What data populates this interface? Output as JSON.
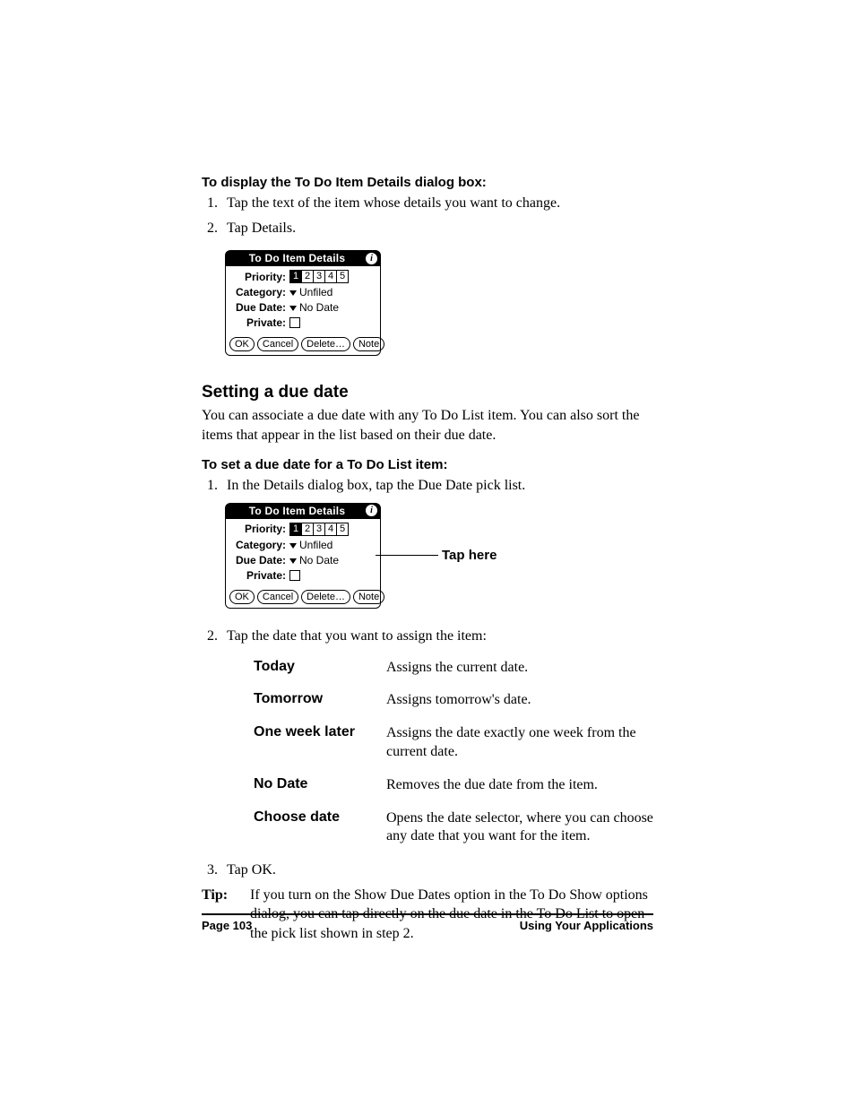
{
  "section1": {
    "heading": "To display the To Do Item Details dialog box:",
    "steps": [
      "Tap the text of the item whose details you want to change.",
      "Tap Details."
    ]
  },
  "dialog": {
    "title": "To Do Item Details",
    "priority_label": "Priority:",
    "priority_values": [
      "1",
      "2",
      "3",
      "4",
      "5"
    ],
    "category_label": "Category:",
    "category_value": "Unfiled",
    "duedate_label": "Due Date:",
    "duedate_value": "No Date",
    "private_label": "Private:",
    "buttons": {
      "ok": "OK",
      "cancel": "Cancel",
      "delete": "Delete…",
      "note": "Note"
    }
  },
  "section2": {
    "heading": "Setting a due date",
    "intro": "You can associate a due date with any To Do List item. You can also sort the items that appear in the list based on their due date.",
    "sub_heading": "To set a due date for a To Do List item:",
    "step1": "In the Details dialog box, tap the Due Date pick list.",
    "callout": "Tap here",
    "step2": "Tap the date that you want to assign the item:"
  },
  "date_options": [
    {
      "name": "Today",
      "desc": "Assigns the current date."
    },
    {
      "name": "Tomorrow",
      "desc": "Assigns tomorrow's date."
    },
    {
      "name": "One week later",
      "desc": "Assigns the date exactly one week from the current date."
    },
    {
      "name": "No Date",
      "desc": "Removes the due date from the item."
    },
    {
      "name": "Choose date",
      "desc": "Opens the date selector, where you can choose any date that you want for the item."
    }
  ],
  "step3": "Tap OK.",
  "tip": {
    "label": "Tip:",
    "body": "If you turn on the Show Due Dates option in the To Do Show options dialog, you can tap directly on the due date in the To Do List to open the pick list shown in step 2."
  },
  "footer": {
    "left": "Page 103",
    "right": "Using Your Applications"
  }
}
